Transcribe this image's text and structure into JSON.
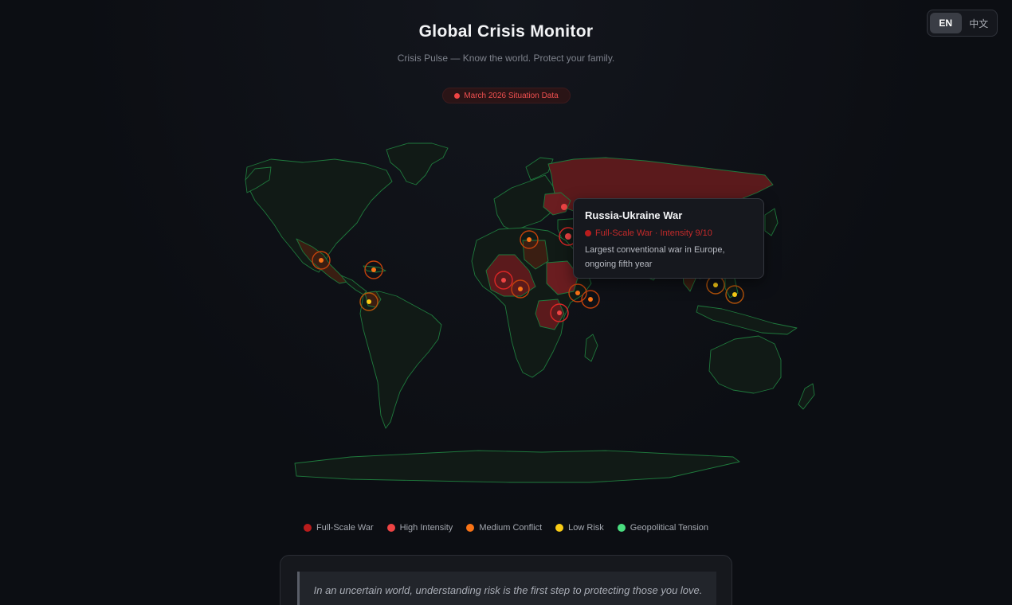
{
  "header": {
    "title": "Global Crisis Monitor",
    "subtitle": "Crisis Pulse — Know the world. Protect your family.",
    "badge": "March 2026 Situation Data"
  },
  "language": {
    "options": [
      "EN",
      "中文"
    ],
    "selected": "EN"
  },
  "tooltip": {
    "title": "Russia-Ukraine War",
    "level": "Full-Scale War · Intensity 9/10",
    "description": "Largest conventional war in Europe, ongoing fifth year"
  },
  "legend": [
    {
      "label": "Full-Scale War",
      "color": "#b91c1c"
    },
    {
      "label": "High Intensity",
      "color": "#ef4444"
    },
    {
      "label": "Medium Conflict",
      "color": "#f97316"
    },
    {
      "label": "Low Risk",
      "color": "#facc15"
    },
    {
      "label": "Geopolitical Tension",
      "color": "#4ade80"
    }
  ],
  "quote": "In an uncertain world, understanding risk is the first step to protecting those you love.",
  "colors": {
    "background": "#0c0e13",
    "land": "#111a16",
    "borders": "#1f7a3d",
    "war_fill": "#5b1a1c",
    "conflict_fill": "#3a1e12"
  },
  "icons": [
    "status-dot-icon"
  ]
}
